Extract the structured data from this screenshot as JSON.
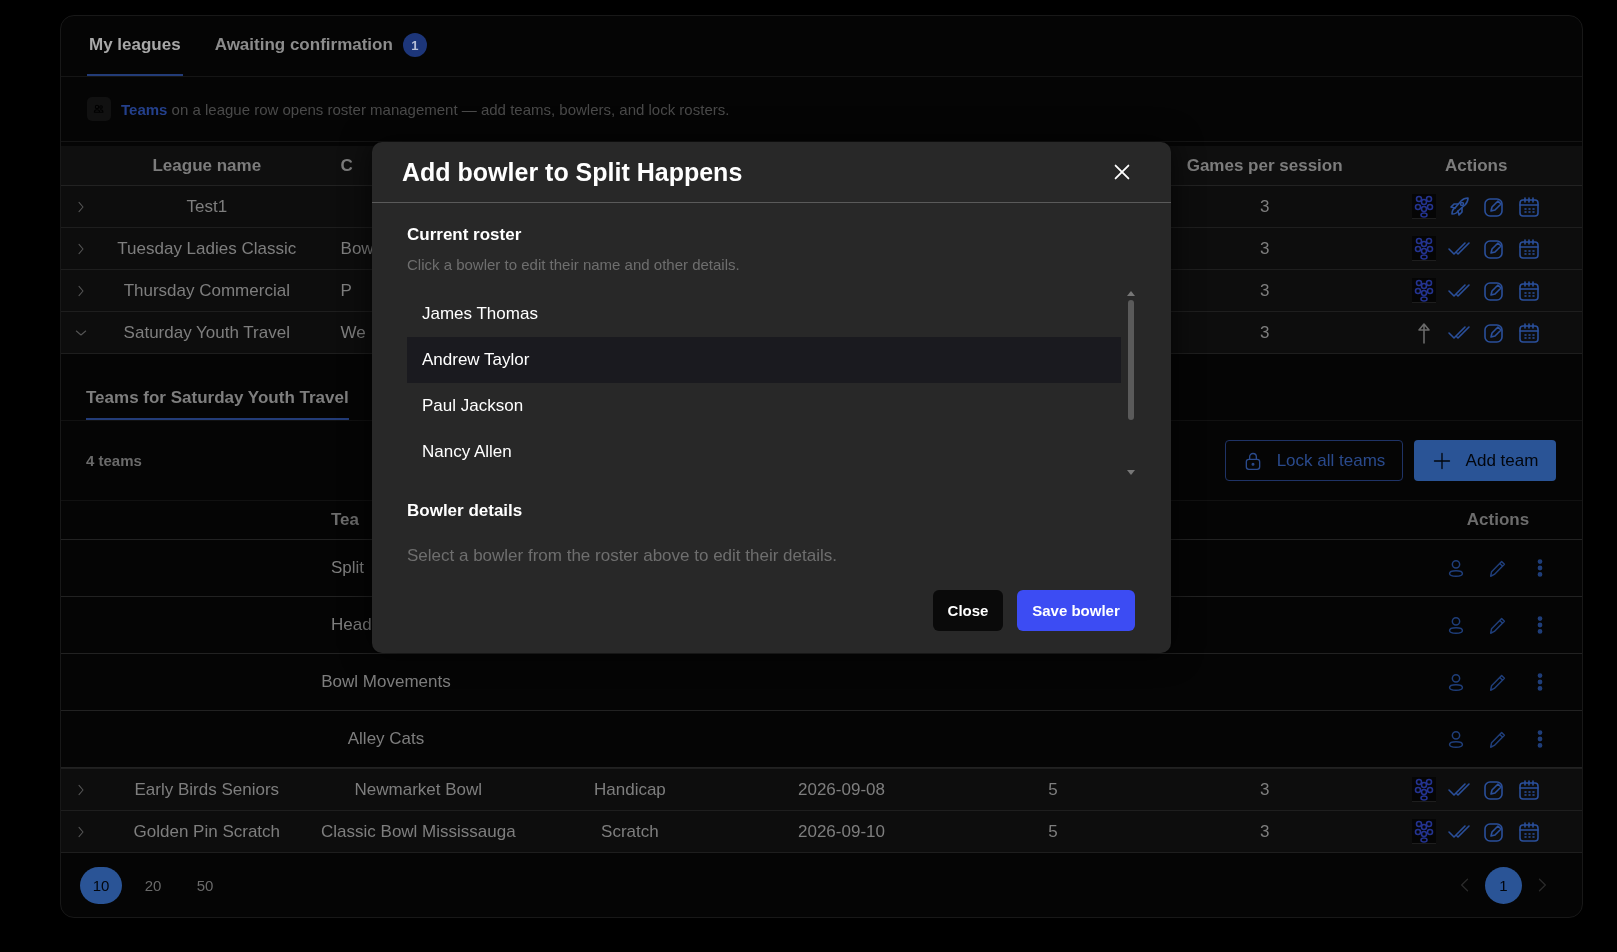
{
  "tabs": [
    {
      "label": "My leagues",
      "selected": true
    },
    {
      "label": "Awaiting confirmation",
      "selected": false,
      "badge": "1"
    }
  ],
  "hint": {
    "link": "Teams",
    "text": " on a league row opens roster management — add teams, bowlers, and lock rosters."
  },
  "leagues": {
    "columns": [
      {
        "text": "League name"
      },
      {
        "text": "C",
        "cut": true
      },
      null,
      null,
      null,
      {
        "text": "Games per session"
      },
      {
        "text": "Actions"
      }
    ],
    "rows": [
      {
        "expanded": false,
        "cells": [
          {
            "text": "Test1"
          },
          null,
          null,
          null,
          null,
          {
            "text": "3"
          }
        ],
        "actions": [
          {
            "kind": "teams"
          },
          {
            "kind": "publish"
          },
          {
            "kind": "edit"
          },
          {
            "kind": "schedule"
          }
        ]
      },
      {
        "expanded": false,
        "cells": [
          {
            "text": "Tuesday Ladies Classic"
          },
          {
            "text": "Bow",
            "cut": true
          },
          null,
          null,
          null,
          {
            "text": "3"
          }
        ],
        "actions": [
          {
            "kind": "teams"
          },
          {
            "kind": "confirm"
          },
          {
            "kind": "edit"
          },
          {
            "kind": "schedule"
          }
        ]
      },
      {
        "expanded": false,
        "cells": [
          {
            "text": "Thursday Commercial"
          },
          {
            "text": "P",
            "cut": true
          },
          null,
          null,
          null,
          {
            "text": "3"
          }
        ],
        "actions": [
          {
            "kind": "teams"
          },
          {
            "kind": "confirm"
          },
          {
            "kind": "edit"
          },
          {
            "kind": "schedule"
          }
        ]
      },
      {
        "expanded": true,
        "cells": [
          {
            "text": "Saturday Youth Travel"
          },
          {
            "text": "We",
            "cut": true
          },
          null,
          null,
          null,
          {
            "text": "3"
          }
        ],
        "actions": [
          {
            "kind": "collapse"
          },
          {
            "kind": "confirm"
          },
          {
            "kind": "edit"
          },
          {
            "kind": "schedule"
          }
        ],
        "teams": {
          "tab": "Teams for Saturday Youth Travel",
          "count": "4 teams",
          "buttons": [
            {
              "kind": "outline",
              "label": "Lock all teams"
            },
            {
              "kind": "primary",
              "label": "Add team"
            }
          ],
          "columns": [
            {
              "text": "Tea",
              "cut": true
            },
            {
              "text": "Actions"
            }
          ],
          "rows": [
            {
              "name": "Split",
              "cut": true
            },
            {
              "name": "Head",
              "cut": true
            },
            {
              "name": "Bowl Movements",
              "cut": false
            },
            {
              "name": "Alley Cats",
              "cut": false
            }
          ]
        }
      },
      {
        "expanded": false,
        "cells": [
          {
            "text": "Early Birds Seniors"
          },
          {
            "text": "Newmarket Bowl"
          },
          {
            "text": "Handicap"
          },
          {
            "text": "2026-09-08"
          },
          {
            "text": "5"
          },
          {
            "text": "3"
          }
        ],
        "actions": [
          {
            "kind": "teams"
          },
          {
            "kind": "confirm"
          },
          {
            "kind": "edit"
          },
          {
            "kind": "schedule"
          }
        ]
      },
      {
        "expanded": false,
        "cells": [
          {
            "text": "Golden Pin Scratch"
          },
          {
            "text": "Classic Bowl Mississauga"
          },
          {
            "text": "Scratch"
          },
          {
            "text": "2026-09-10"
          },
          {
            "text": "5"
          },
          {
            "text": "3"
          }
        ],
        "actions": [
          {
            "kind": "teams"
          },
          {
            "kind": "confirm"
          },
          {
            "kind": "edit"
          },
          {
            "kind": "schedule"
          }
        ]
      }
    ]
  },
  "pagination": {
    "page_sizes": [
      {
        "label": "10",
        "selected": true
      },
      {
        "label": "20",
        "selected": false
      },
      {
        "label": "50",
        "selected": false
      }
    ],
    "pages": [
      {
        "label": "1",
        "selected": true
      }
    ]
  },
  "dialog": {
    "title": "Add bowler to Split Happens",
    "roster_heading": "Current roster",
    "roster_hint": "Click a bowler to edit their name and other details.",
    "roster": [
      {
        "name": "James Thomas",
        "selected": false
      },
      {
        "name": "Andrew Taylor",
        "selected": true
      },
      {
        "name": "Paul Jackson",
        "selected": false
      },
      {
        "name": "Nancy Allen",
        "selected": false
      }
    ],
    "details_heading": "Bowler details",
    "details_hint": "Select a bowler from the roster above to edit their details.",
    "buttons": [
      {
        "kind": "secondary",
        "label": "Close"
      },
      {
        "kind": "primary",
        "label": "Save bowler"
      }
    ]
  }
}
